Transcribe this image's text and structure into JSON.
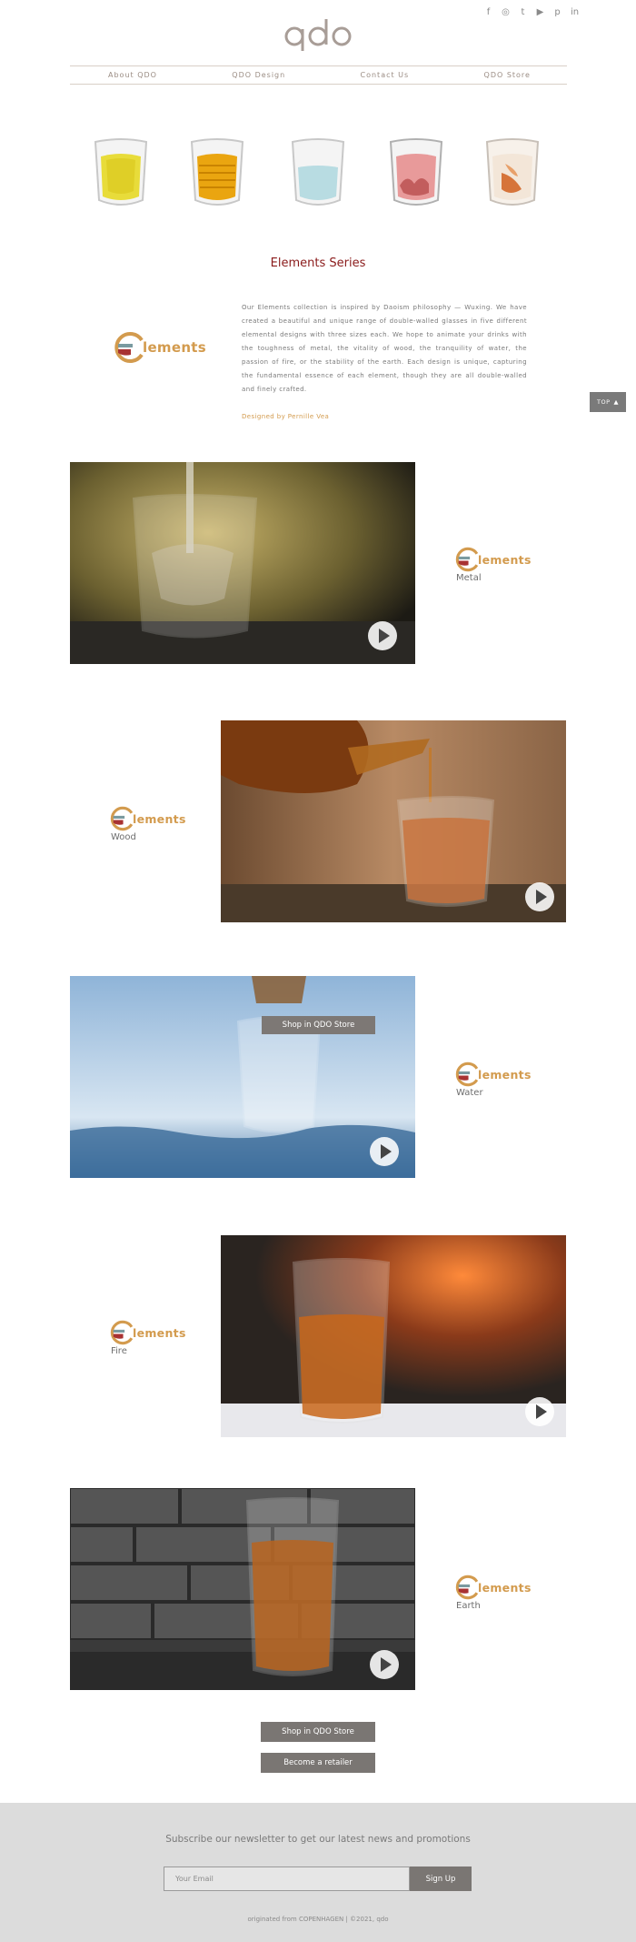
{
  "header": {
    "social_icons": [
      "facebook-icon",
      "instagram-icon",
      "twitter-icon",
      "youtube-icon",
      "pinterest-icon",
      "linkedin-icon"
    ],
    "social_glyphs": [
      "f",
      "◎",
      "t",
      "▶",
      "p",
      "in"
    ]
  },
  "nav": {
    "items": [
      {
        "label": "About QDO"
      },
      {
        "label": "QDO Design"
      },
      {
        "label": "Contact Us"
      },
      {
        "label": "QDO Store"
      }
    ]
  },
  "glasses": [
    "metal-glass",
    "wood-glass",
    "water-glass",
    "fire-glass",
    "earth-glass"
  ],
  "series_title": "Elements Series",
  "brand_word": "lements",
  "intro": {
    "text": "Our Elements collection is inspired by Daoism philosophy — Wuxing. We have created a beautiful and unique range of double-walled glasses in five different elemental designs with three sizes each. We hope to animate your drinks with the toughness of metal, the vitality of wood, the tranquility of water, the passion of fire, or the stability of the earth. Each design is unique, capturing the fundamental essence of each element, though they are all double-walled and finely crafted.",
    "designed_by": "Designed by Pernille Vea"
  },
  "top_button": "TOP",
  "rows": [
    {
      "name": "Metal"
    },
    {
      "name": "Wood"
    },
    {
      "name": "Water"
    },
    {
      "name": "Fire"
    },
    {
      "name": "Earth"
    }
  ],
  "shop_overlay": "Shop in QDO Store",
  "buttons": {
    "shop": "Shop in QDO Store",
    "retailer": "Become a retailer"
  },
  "footer": {
    "subscribe": "Subscribe our newsletter to get our latest news and promotions",
    "email_placeholder": "Your Email",
    "signup": "Sign Up",
    "copyright": "originated from COPENHAGEN  |  ©2021, qdo"
  },
  "colors": {
    "accent_gold": "#d39b4e",
    "title_red": "#8a1a1a",
    "button_grey": "#7a7673"
  }
}
